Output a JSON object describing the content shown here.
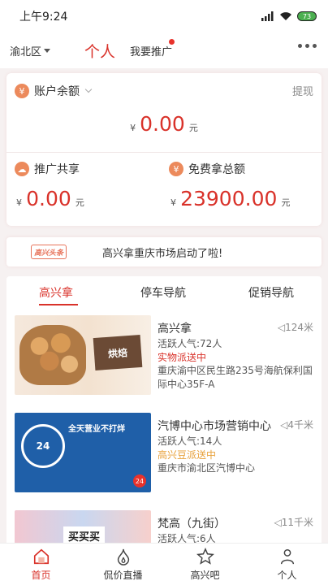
{
  "status_bar": {
    "time": "上午9:24",
    "battery": "73"
  },
  "top_nav": {
    "city": "渝北区",
    "title": "个人",
    "promote": "我要推广"
  },
  "balance": {
    "label": "账户余额",
    "withdraw": "提现",
    "yen": "¥",
    "amount": "0.00",
    "unit": "元",
    "share": {
      "label": "推广共享",
      "yen": "¥",
      "amount": "0.00",
      "unit": "元"
    },
    "free": {
      "label": "免费拿总额",
      "yen": "¥",
      "amount": "23900.00",
      "unit": "元"
    }
  },
  "news": {
    "badge": "高兴头条",
    "text": "高兴拿重庆市场启动了啦!"
  },
  "tabs": [
    "高兴拿",
    "停车导航",
    "促销导航"
  ],
  "stores": [
    {
      "name": "高兴拿",
      "distance": "124米",
      "popularity": "活跃人气:72人",
      "status": "实物派送中",
      "status_color": "#d9322a",
      "address": "重庆渝中区民生路235号海航保利国际中心35F-A",
      "thumb_text": "烘焙"
    },
    {
      "name": "汽博中心市场营销中心",
      "distance": "4千米",
      "popularity": "活跃人气:14人",
      "status": "高兴豆派送中",
      "status_color": "#e8a13a",
      "address": "重庆市渝北区汽博中心",
      "thumb_clock": "24",
      "thumb_banner": "全天营业不打烊",
      "thumb_badge": "24"
    },
    {
      "name": "梵高（九街）",
      "distance": "11千米",
      "popularity": "活跃人气:6人",
      "thumb_text": "买买买"
    }
  ],
  "tabbar": [
    "首页",
    "侃价直播",
    "高兴吧",
    "个人"
  ]
}
